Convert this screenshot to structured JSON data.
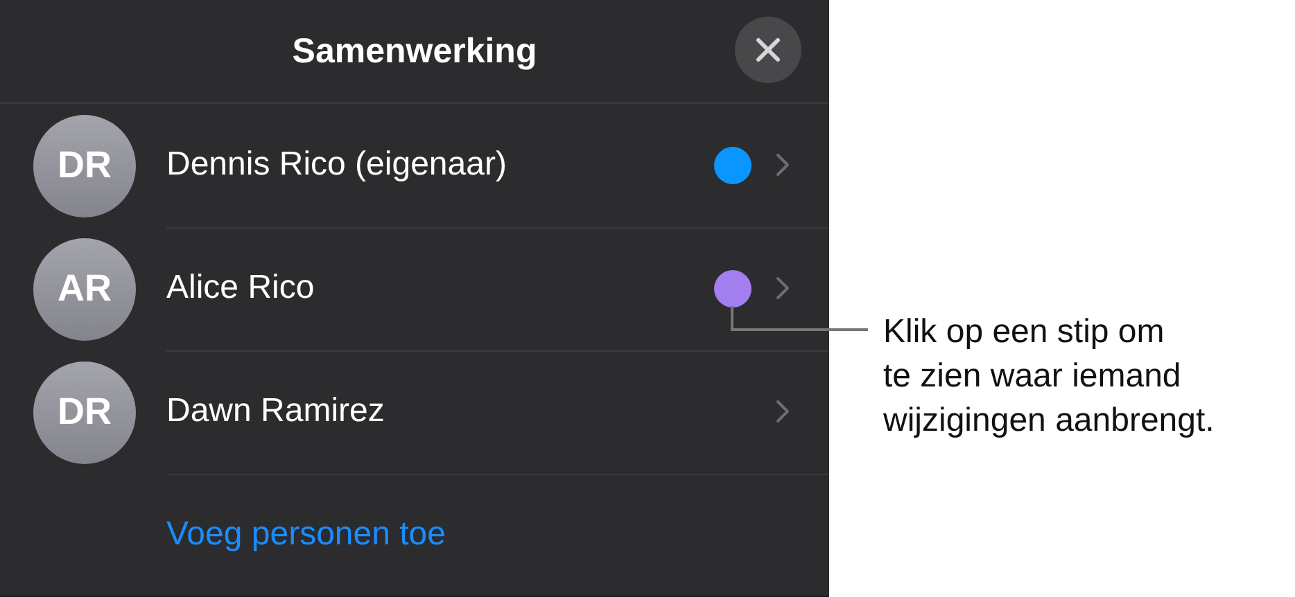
{
  "panel": {
    "title": "Samenwerking"
  },
  "people": [
    {
      "initials": "DR",
      "name": "Dennis Rico (eigenaar)",
      "color": "#0a95ff"
    },
    {
      "initials": "AR",
      "name": "Alice Rico",
      "color": "#a37ef0"
    },
    {
      "initials": "DR",
      "name": "Dawn Ramirez"
    }
  ],
  "add_link": "Voeg personen toe",
  "callout": {
    "lines": [
      "Klik op een stip om",
      "te zien waar iemand",
      "wijzigingen aanbrengt."
    ]
  }
}
